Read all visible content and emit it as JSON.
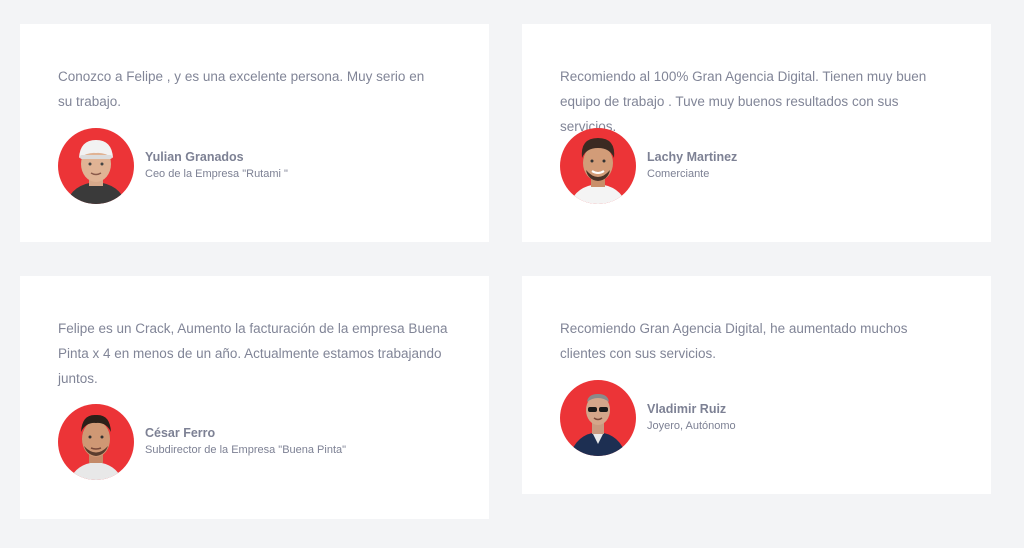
{
  "testimonials": [
    {
      "quote": "Conozco a Felipe , y es una excelente persona. Muy serio en su trabajo.",
      "name": "Yulian Granados",
      "role": "Ceo de la Empresa \"Rutami \""
    },
    {
      "quote": "Recomiendo al 100% Gran Agencia Digital. Tienen muy buen equipo de trabajo . Tuve muy buenos resultados con sus servicios.",
      "name": "Lachy Martinez",
      "role": "Comerciante"
    },
    {
      "quote": "Felipe es un Crack, Aumento la facturación de la empresa Buena Pinta x 4 en menos de un año. Actualmente estamos trabajando juntos.",
      "name": "César Ferro",
      "role": "Subdirector de la Empresa \"Buena Pinta\""
    },
    {
      "quote": "Recomiendo Gran Agencia Digital, he aumentado muchos clientes con sus servicios.",
      "name": "Vladimir Ruiz",
      "role": "Joyero, Autónomo"
    }
  ],
  "colors": {
    "page_background": "#f3f4f6",
    "card_background": "#ffffff",
    "avatar_background": "#ec3437",
    "text": "#818597"
  }
}
